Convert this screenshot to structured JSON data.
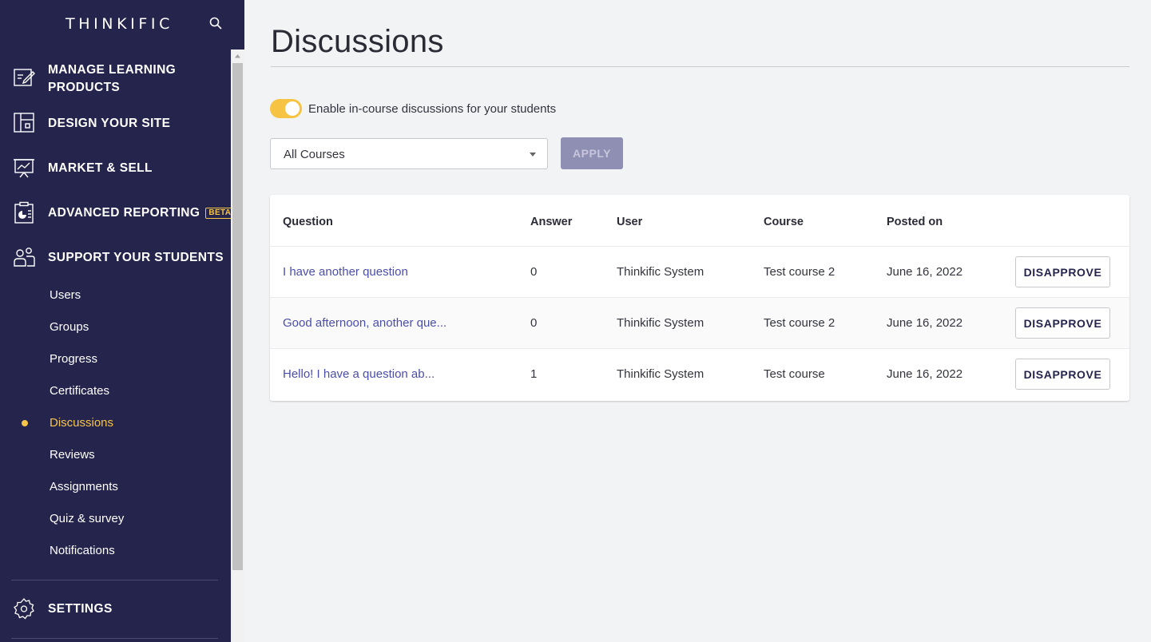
{
  "brand": {
    "name": "THINKIFIC"
  },
  "sidebar": {
    "main_items": [
      {
        "label_line1": "MANAGE LEARNING",
        "label_line2": "PRODUCTS",
        "icon": "edit-doc-icon"
      },
      {
        "label": "DESIGN YOUR SITE",
        "icon": "layout-icon"
      },
      {
        "label": "MARKET & SELL",
        "icon": "presentation-chart-icon"
      },
      {
        "label": "ADVANCED REPORTING",
        "badge": "BETA",
        "icon": "report-clipboard-icon"
      },
      {
        "label": "SUPPORT YOUR STUDENTS",
        "icon": "people-icon"
      }
    ],
    "sub_items": [
      "Users",
      "Groups",
      "Progress",
      "Certificates",
      "Discussions",
      "Reviews",
      "Assignments",
      "Quiz & survey",
      "Notifications"
    ],
    "active_sub_item": "Discussions",
    "settings": {
      "label": "SETTINGS",
      "icon": "gear-icon"
    }
  },
  "page": {
    "title": "Discussions",
    "toggle": {
      "enabled": true,
      "label": "Enable in-course discussions for your students"
    },
    "filter": {
      "selected": "All Courses",
      "apply_label": "APPLY"
    }
  },
  "table": {
    "headers": {
      "question": "Question",
      "answer": "Answer",
      "user": "User",
      "course": "Course",
      "posted_on": "Posted on"
    },
    "rows": [
      {
        "question": "I have another question",
        "answer": "0",
        "user": "Thinkific System",
        "course": "Test course 2",
        "posted_on": "June 16, 2022",
        "action": "DISAPPROVE"
      },
      {
        "question": "Good afternoon, another que...",
        "answer": "0",
        "user": "Thinkific System",
        "course": "Test course 2",
        "posted_on": "June 16, 2022",
        "action": "DISAPPROVE"
      },
      {
        "question": "Hello! I have a question ab...",
        "answer": "1",
        "user": "Thinkific System",
        "course": "Test course",
        "posted_on": "June 16, 2022",
        "action": "DISAPPROVE"
      }
    ]
  },
  "colors": {
    "sidebar_bg": "#24244d",
    "accent_yellow": "#f7c548",
    "link": "#4b4ea8",
    "apply_bg": "#8f8eb3"
  }
}
